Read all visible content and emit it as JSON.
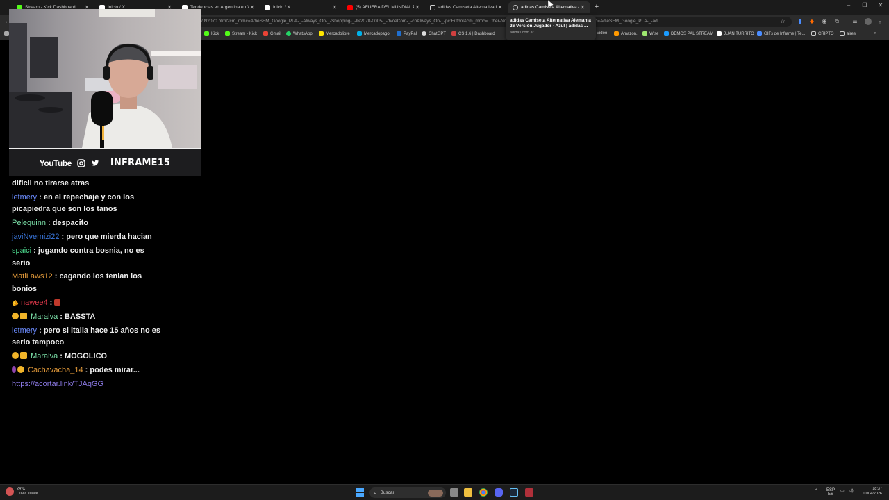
{
  "browser": {
    "tabs": [
      {
        "title": "Stream - Kick Dashboard",
        "favicon_color": "#53fc18"
      },
      {
        "title": "Inicio / X",
        "favicon_color": "#ffffff"
      },
      {
        "title": "Tendencias en Argentina en X",
        "favicon_color": "#ffffff"
      },
      {
        "title": "Inicio / X",
        "favicon_color": "#ffffff"
      },
      {
        "title": "(5) AFUERA DEL MUNDIAL POR",
        "favicon_color": "#ff0000"
      },
      {
        "title": "adidas Camiseta Alternativa Ita",
        "favicon_color": "#cccccc"
      },
      {
        "title": "adidas Camiseta Alternativa Ale",
        "favicon_color": "#cccccc"
      }
    ],
    "new_tab_glyph": "+",
    "window_controls": [
      "–",
      "❐",
      "✕"
    ],
    "url": "/IN2070.html?cm_mmc=AdieSEM_Google_PLA-_-Always_On-_-Shopping-_-IN2070-0005-_-dvceCom-_-cnAlways_On-_-pc:Fútbol&cm_mmc=...ther-None-AR-LATAM-eCom-Paid_Search&cm_mmc=AdieSEM_Google_PLA-_-adi...",
    "bookmarks": [
      {
        "label": "Kick",
        "color": "#53fc18"
      },
      {
        "label": "Stream - Kick",
        "color": "#53fc18"
      },
      {
        "label": "Gmail",
        "color": "#ea4335"
      },
      {
        "label": "WhatsApp",
        "color": "#25d366"
      },
      {
        "label": "Mercadolibre",
        "color": "#ffe600"
      },
      {
        "label": "Mercadopago",
        "color": "#00b1ea"
      },
      {
        "label": "PayPal",
        "color": "#1f6fd0"
      },
      {
        "label": "ChatGPT",
        "color": "#dddddd"
      },
      {
        "label": "CS 1.6 | Dashboard",
        "color": "#d04040"
      },
      {
        "label": "Video",
        "color": "#888888"
      },
      {
        "label": "Amazon.",
        "color": "#ff9900"
      },
      {
        "label": "Wise",
        "color": "#9fe870"
      },
      {
        "label": "DEMOS PAL STREAM",
        "color": "#1b9cff"
      },
      {
        "label": "JUAN TURRITO",
        "color": "#ffffff"
      },
      {
        "label": "GIFs de Inframe | Te...",
        "color": "#4a8cff"
      },
      {
        "label": "CRIPTO",
        "color": "#cccccc"
      },
      {
        "label": "aires",
        "color": "#cccccc"
      }
    ],
    "tooltip": {
      "title": "adidas Camiseta Alternativa Alemania 26 Versión Jugador - Azul | adidas ...",
      "domain": "adidas.com.ar"
    }
  },
  "stream_overlay": {
    "youtube_label": "YouTube",
    "handle": "INFRAME15"
  },
  "chat": {
    "messages": [
      {
        "user": "",
        "user_color": "",
        "text": "dificil no tirarse atras"
      },
      {
        "user": "letmery",
        "user_color": "#6b8cff",
        "text": " : en el repechaje y con los picapiedra que son los tanos"
      },
      {
        "user": "Pelequinn",
        "user_color": "#7be0a8",
        "text": " : despacito"
      },
      {
        "user": "javiNvernizi22",
        "user_color": "#3a78e0",
        "text": " : pero que mierda hacian"
      },
      {
        "user": "spaici",
        "user_color": "#4ad48a",
        "text": " : jugando contra bosnia, no es serio"
      },
      {
        "user": "MatiLaws12",
        "user_color": "#e39a3a",
        "text": " : cagando los tenian los bonios"
      },
      {
        "user": "nawee4",
        "user_color": "#e0384a",
        "text": " : ",
        "prefix": "🫵",
        "emote": true
      },
      {
        "user": "Maralva",
        "user_color": "#7be0a8",
        "text": " : BASSTA",
        "badges": true
      },
      {
        "user": "letmery",
        "user_color": "#6b8cff",
        "text": " : pero si italia hace 15 años no es serio tampoco"
      },
      {
        "user": "Maralva",
        "user_color": "#7be0a8",
        "text": " : MOGOLICO",
        "badges": true
      },
      {
        "user": "Cachavacha_14",
        "user_color": "#e39a3a",
        "text": " : podes mirar...",
        "badges": true
      },
      {
        "user": "",
        "user_color": "",
        "text": "",
        "link": "https://acortar.link/TJAqGG"
      }
    ]
  },
  "taskbar": {
    "weather_temp": "24°C",
    "weather_desc": "Lluvia suave",
    "search_placeholder": "Buscar",
    "lang_top": "ESP",
    "lang_bottom": "ES",
    "time": "18:37",
    "date": "01/04/2026"
  }
}
